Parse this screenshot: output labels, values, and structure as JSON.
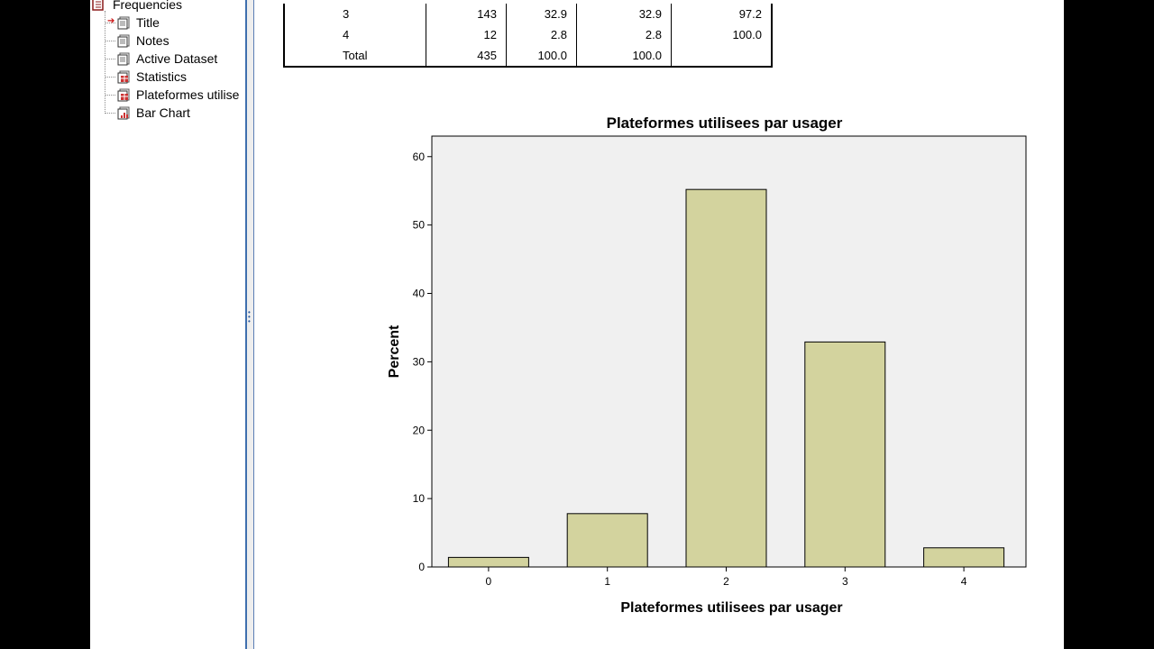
{
  "outline": {
    "root_label": "Frequencies",
    "items": [
      {
        "label": "Title",
        "icon": "document-icon",
        "current": true
      },
      {
        "label": "Notes",
        "icon": "document-icon",
        "current": false
      },
      {
        "label": "Active Dataset",
        "icon": "document-icon",
        "current": false
      },
      {
        "label": "Statistics",
        "icon": "table-icon",
        "current": false
      },
      {
        "label": "Plateformes utilise",
        "icon": "table-icon",
        "current": false
      },
      {
        "label": "Bar Chart",
        "icon": "chart-icon",
        "current": false
      }
    ]
  },
  "table": {
    "rows": [
      [
        "3",
        "143",
        "32.9",
        "32.9",
        "97.2"
      ],
      [
        "4",
        "12",
        "2.8",
        "2.8",
        "100.0"
      ],
      [
        "Total",
        "435",
        "100.0",
        "100.0",
        ""
      ]
    ]
  },
  "colors": {
    "bar_fill": "#d3d39e",
    "plot_bg": "#f0f0f0",
    "splitter_blue": "#3f6fae"
  },
  "chart_data": {
    "type": "bar",
    "title": "Plateformes utilisees par usager",
    "xlabel": "Plateformes utilisees par usager",
    "ylabel": "Percent",
    "categories": [
      "0",
      "1",
      "2",
      "3",
      "4"
    ],
    "values": [
      1.4,
      7.8,
      55.2,
      32.9,
      2.8
    ],
    "yticks": [
      0,
      10,
      20,
      30,
      40,
      50,
      60
    ],
    "ylim": [
      0,
      63
    ],
    "grid": false,
    "legend": "none"
  }
}
